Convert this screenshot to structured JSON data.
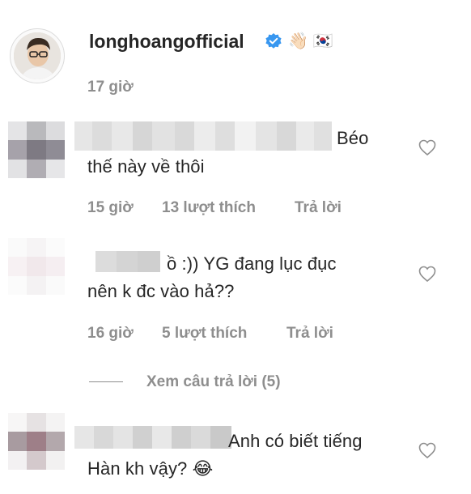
{
  "post": {
    "username": "longhoangofficial",
    "emoji": "👋🏻 🇰🇷",
    "time": "17 giờ"
  },
  "comments": [
    {
      "text_line1": "Béo",
      "text_line2": "thế này về thôi",
      "time": "15 giờ",
      "likes": "13 lượt thích",
      "reply": "Trả lời"
    },
    {
      "text_line1": "ồ :)) YG đang lục đục",
      "text_line2": "nên k đc vào hả??",
      "time": "16 giờ",
      "likes": "5 lượt thích",
      "reply": "Trả lời"
    },
    {
      "text_line1": "Anh có biết tiếng",
      "text_line2": "Hàn kh vậy? 😂"
    }
  ],
  "view_replies": "Xem câu trả lời (5)"
}
